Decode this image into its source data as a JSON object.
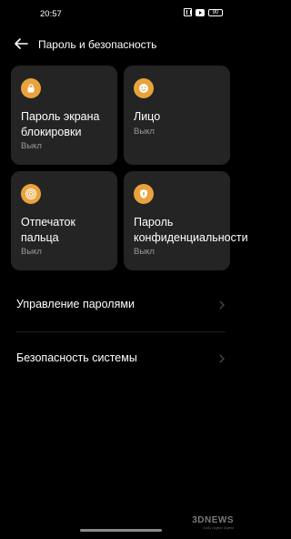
{
  "status_bar": {
    "time": "20:57",
    "battery": "90"
  },
  "header": {
    "title": "Пароль и безопасность"
  },
  "cards": [
    {
      "title": "Пароль экрана блокировки",
      "status": "Выкл",
      "icon": "lock-icon"
    },
    {
      "title": "Лицо",
      "status": "Выкл",
      "icon": "face-icon"
    },
    {
      "title": "Отпечаток пальца",
      "status": "Выкл",
      "icon": "fingerprint-icon"
    },
    {
      "title": "Пароль конфиденциальности",
      "status": "Выкл",
      "icon": "shield-icon"
    }
  ],
  "rows": [
    {
      "label": "Управление паролями"
    },
    {
      "label": "Безопасность системы"
    }
  ],
  "watermark": {
    "logo": "3DNEWS",
    "sub": "Daily Digital Digest"
  },
  "colors": {
    "accent": "#E8A33C",
    "card": "#242424",
    "background": "#000000"
  }
}
